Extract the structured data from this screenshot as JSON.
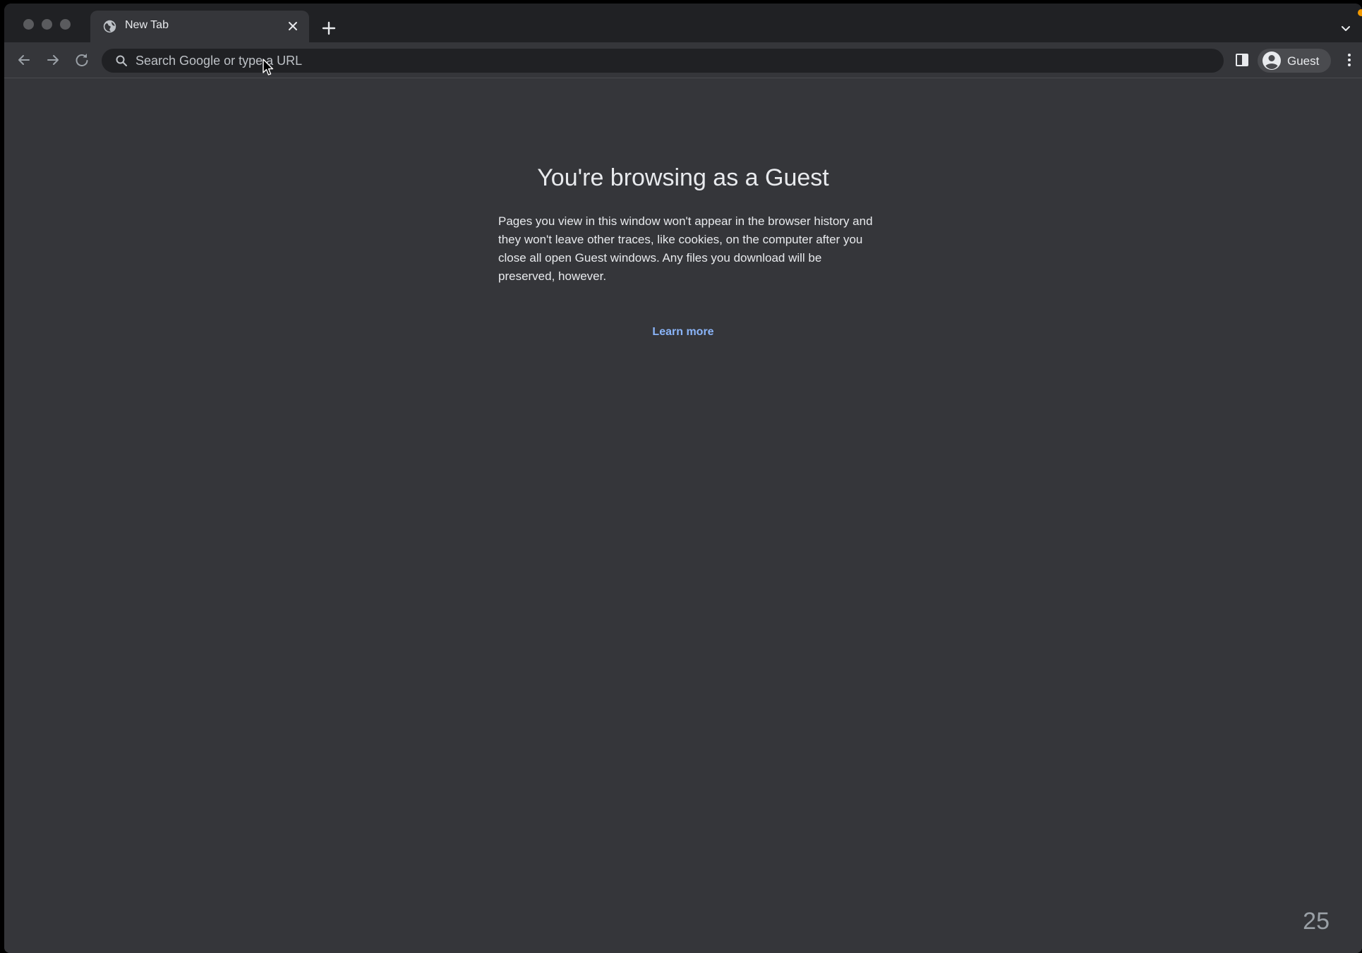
{
  "tab": {
    "title": "New Tab"
  },
  "omnibox": {
    "placeholder": "Search Google or type a URL",
    "value": ""
  },
  "profile": {
    "label": "Guest"
  },
  "guest_page": {
    "title": "You're browsing as a Guest",
    "description": "Pages you view in this window won't appear in the browser history and they won't leave other traces, like cookies, on the computer after you close all open Guest windows. Any files you download will be preserved, however.",
    "learn_more": "Learn more"
  },
  "page_counter": "25",
  "colors": {
    "background": "#35363a",
    "tabstrip": "#202124",
    "text": "#e8eaed",
    "link": "#8ab4f8",
    "recording_dot": "#f29900"
  },
  "icons": {
    "tab_favicon": "globe-icon",
    "tab_close": "close-icon",
    "new_tab": "plus-icon",
    "tab_search": "chevron-down-icon",
    "back": "arrow-left-icon",
    "forward": "arrow-right-icon",
    "reload": "reload-icon",
    "omnibox": "search-icon",
    "side_panel": "side-panel-icon",
    "avatar": "account-circle-icon",
    "menu": "kebab-menu-icon"
  }
}
